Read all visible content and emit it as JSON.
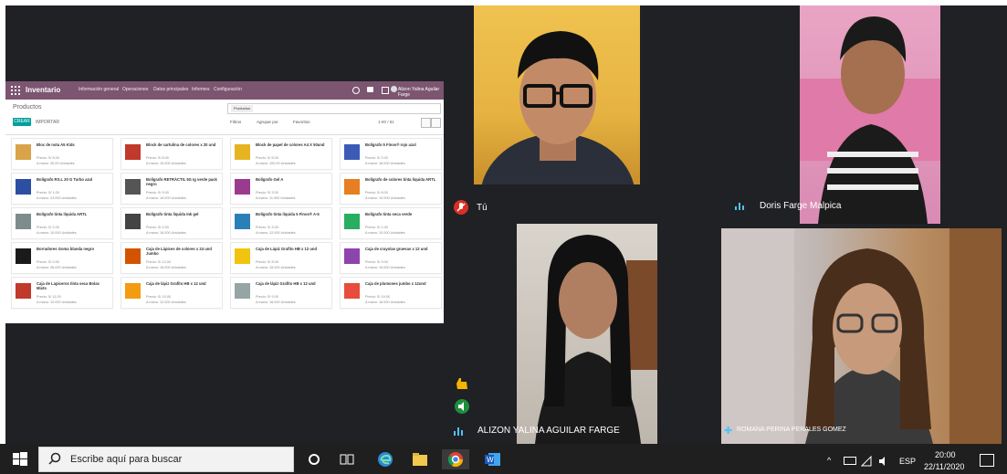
{
  "shared_screen": {
    "app_title": "Inventario",
    "menu": [
      "Información general",
      "Operaciones",
      "Datos principales",
      "Informes",
      "Configuración"
    ],
    "user": "Alizon Yalina Aguilar Farge",
    "breadcrumb": "Productos",
    "create_button": "CREAR",
    "import_button": "IMPORTAR",
    "search_facet": "Productos",
    "filters": [
      "Filtros",
      "Agrupar por",
      "Favoritos"
    ],
    "pager": "1-80 / 81",
    "products": [
      {
        "name": "Bloc de nota A5 Kids",
        "price": "Precio: S/ 8.00",
        "stock": "A mano: 30.00 Unidades",
        "color": "#d9a34a"
      },
      {
        "name": "Block de cartulina de colores x 20 und",
        "price": "Precio: S/ 8.00",
        "stock": "A mano: 15.000 Unidades",
        "color": "#c0392b"
      },
      {
        "name": "Block de papel de colores A4 X 50und",
        "price": "Precio: S/ 6.00",
        "stock": "A mano: 100.00 Unidades",
        "color": "#e6b422"
      },
      {
        "name": "Bolígrafo 5 Finos® rojo azul",
        "price": "Precio: S/ 2.00",
        "stock": "A mano: 18.000 Unidades",
        "color": "#3b5bb7"
      },
      {
        "name": "Bolígrafo RS.L 20 G Turbo azul",
        "price": "Precio: S/ 1.00",
        "stock": "A mano: 24.000 Unidades",
        "color": "#2c4fa3"
      },
      {
        "name": "Bolígrafo RETRÁCTIL 5G Ig verde pack negro",
        "price": "Precio: S/ 9.00",
        "stock": "A mano: 16.000 Unidades",
        "color": "#555555"
      },
      {
        "name": "Bolígrafo Gel A",
        "price": "Precio: S/ 3.00",
        "stock": "A mano: 11.000 Unidades",
        "color": "#9b3b8f"
      },
      {
        "name": "Bolígrafo de colores tinta líquida ARTL",
        "price": "Precio: S/ 8.00",
        "stock": "A mano: 10.000 Unidades",
        "color": "#e67e22"
      },
      {
        "name": "Bolígrafo tinta líquida ARTL",
        "price": "Precio: S/ 2.00",
        "stock": "A mano: 10.000 Unidades",
        "color": "#7f8c8d"
      },
      {
        "name": "Bolígrafo tinta líquida Ink gel",
        "price": "Precio: S/ 2.00",
        "stock": "A mano: 16.000 Unidades",
        "color": "#444444"
      },
      {
        "name": "Bolígrafo tinta líquida 5 Finos® A-5",
        "price": "Precio: S/ 3.00",
        "stock": "A mano: 12.000 Unidades",
        "color": "#2980b9"
      },
      {
        "name": "Bolígrafo tinta seca verde",
        "price": "Precio: S/ 1.00",
        "stock": "A mano: 10.000 Unidades",
        "color": "#27ae60"
      },
      {
        "name": "Borradores Goma blanda negro",
        "price": "Precio: S/ 0.50",
        "stock": "A mano: 36.000 Unidades",
        "color": "#1a1a1a"
      },
      {
        "name": "Caja de Lápices de colores x 24 und Jumbo",
        "price": "Precio: S/ 12.00",
        "stock": "A mano: 16.000 Unidades",
        "color": "#d35400"
      },
      {
        "name": "Caja de Lápiz Grafito HB x 12 und",
        "price": "Precio: S/ 8.00",
        "stock": "A mano: 15.000 Unidades",
        "color": "#f1c40f"
      },
      {
        "name": "Caja de crayolas gruesas x 12 und",
        "price": "Precio: S/ 9.00",
        "stock": "A mano: 15.000 Unidades",
        "color": "#8e44ad"
      },
      {
        "name": "Caja de Lapiceros tinta seca Bolas Mixto",
        "price": "Precio: S/ 11.00",
        "stock": "A mano: 10.000 Unidades",
        "color": "#c0392b"
      },
      {
        "name": "Caja de lápiz Grafito HB x 12 und",
        "price": "Precio: S/ 10.00",
        "stock": "A mano: 12.000 Unidades",
        "color": "#f39c12"
      },
      {
        "name": "Caja de lápiz Grafito HB x 12 und",
        "price": "Precio: S/ 9.00",
        "stock": "A mano: 16.000 Unidades",
        "color": "#95a5a6"
      },
      {
        "name": "Caja de plumones jumbo x 12und",
        "price": "Precio: S/ 15.00",
        "stock": "A mano: 18.000 Unidades",
        "color": "#e74c3c"
      }
    ]
  },
  "participants": {
    "self_name": "Tú",
    "doris": "Doris Farge Malpica",
    "alizon": "ALIZON YALINA AGUILAR FARGE",
    "romana": "ROMANA PERINA PERALES GOMEZ"
  },
  "taskbar": {
    "search_placeholder": "Escribe aquí para buscar",
    "language": "ESP",
    "time": "20:00",
    "date": "22/11/2020"
  },
  "colors": {
    "meet_bg": "#202124",
    "odoo_header": "#7c5571",
    "odoo_accent": "#00a09d",
    "speaking": "#4fc3f7",
    "muted": "#d93025"
  }
}
